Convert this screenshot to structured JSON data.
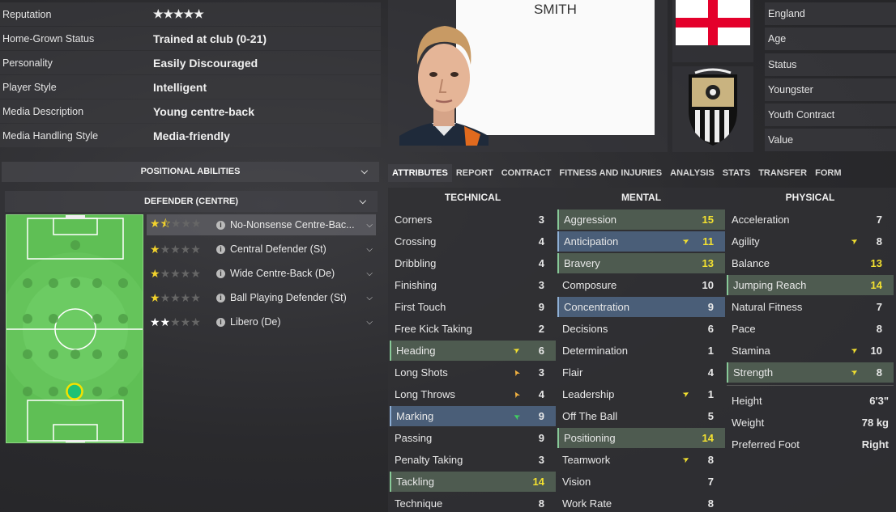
{
  "info": [
    {
      "label": "Reputation",
      "value": "★★★★★"
    },
    {
      "label": "Home-Grown Status",
      "value": "Trained at club (0-21)"
    },
    {
      "label": "Personality",
      "value": "Easily Discouraged"
    },
    {
      "label": "Player Style",
      "value": "Intelligent"
    },
    {
      "label": "Media Description",
      "value": "Young centre-back"
    },
    {
      "label": "Media Handling Style",
      "value": "Media-friendly"
    }
  ],
  "player_name": "SMITH",
  "side": [
    "England",
    "Age",
    "Status",
    "Youngster",
    "Youth Contract",
    "Value"
  ],
  "positional_label": "POSITIONAL ABILITIES",
  "position_label": "DEFENDER (CENTRE)",
  "roles": [
    {
      "name": "No-Nonsense Centre-Bac...",
      "stars": 1.5
    },
    {
      "name": "Central Defender (St)",
      "stars": 1
    },
    {
      "name": "Wide Centre-Back (De)",
      "stars": 1
    },
    {
      "name": "Ball Playing Defender (St)",
      "stars": 1
    },
    {
      "name": "Libero (De)",
      "stars": 2
    }
  ],
  "tabs": [
    "ATTRIBUTES",
    "REPORT",
    "CONTRACT",
    "FITNESS AND INJURIES",
    "ANALYSIS",
    "STATS",
    "TRANSFER",
    "FORM"
  ],
  "headers": {
    "technical": "TECHNICAL",
    "mental": "MENTAL",
    "physical": "PHYSICAL"
  },
  "technical": [
    {
      "n": "Corners",
      "v": "3"
    },
    {
      "n": "Crossing",
      "v": "4"
    },
    {
      "n": "Dribbling",
      "v": "4"
    },
    {
      "n": "Finishing",
      "v": "3"
    },
    {
      "n": "First Touch",
      "v": "9"
    },
    {
      "n": "Free Kick Taking",
      "v": "2"
    },
    {
      "n": "Heading",
      "v": "6",
      "h": "g",
      "a": "up"
    },
    {
      "n": "Long Shots",
      "v": "3",
      "a": "warn"
    },
    {
      "n": "Long Throws",
      "v": "4",
      "a": "warn"
    },
    {
      "n": "Marking",
      "v": "9",
      "h": "b",
      "a": "ok"
    },
    {
      "n": "Passing",
      "v": "9"
    },
    {
      "n": "Penalty Taking",
      "v": "3"
    },
    {
      "n": "Tackling",
      "v": "14",
      "h": "g",
      "y": true
    },
    {
      "n": "Technique",
      "v": "8"
    }
  ],
  "mental": [
    {
      "n": "Aggression",
      "v": "15",
      "h": "g",
      "y": true
    },
    {
      "n": "Anticipation",
      "v": "11",
      "h": "b",
      "a": "up",
      "y": true
    },
    {
      "n": "Bravery",
      "v": "13",
      "h": "g",
      "y": true
    },
    {
      "n": "Composure",
      "v": "10"
    },
    {
      "n": "Concentration",
      "v": "9",
      "h": "b"
    },
    {
      "n": "Decisions",
      "v": "6"
    },
    {
      "n": "Determination",
      "v": "1"
    },
    {
      "n": "Flair",
      "v": "4"
    },
    {
      "n": "Leadership",
      "v": "1",
      "a": "up"
    },
    {
      "n": "Off The Ball",
      "v": "5"
    },
    {
      "n": "Positioning",
      "v": "14",
      "h": "g",
      "y": true
    },
    {
      "n": "Teamwork",
      "v": "8",
      "a": "up"
    },
    {
      "n": "Vision",
      "v": "7"
    },
    {
      "n": "Work Rate",
      "v": "8"
    }
  ],
  "physical": [
    {
      "n": "Acceleration",
      "v": "7"
    },
    {
      "n": "Agility",
      "v": "8",
      "a": "up"
    },
    {
      "n": "Balance",
      "v": "13",
      "y": true
    },
    {
      "n": "Jumping Reach",
      "v": "14",
      "h": "g",
      "y": true
    },
    {
      "n": "Natural Fitness",
      "v": "7"
    },
    {
      "n": "Pace",
      "v": "8"
    },
    {
      "n": "Stamina",
      "v": "10",
      "a": "up"
    },
    {
      "n": "Strength",
      "v": "8",
      "h": "g",
      "a": "up"
    }
  ],
  "body": [
    {
      "n": "Height",
      "v": "6'3\""
    },
    {
      "n": "Weight",
      "v": "78 kg"
    },
    {
      "n": "Preferred Foot",
      "v": "Right"
    }
  ],
  "colors": {
    "accent_yellow": "#f3e130",
    "green_highlight": "#4e5b50",
    "blue_highlight": "#4a5e78",
    "pitch": "#5fbf55"
  }
}
